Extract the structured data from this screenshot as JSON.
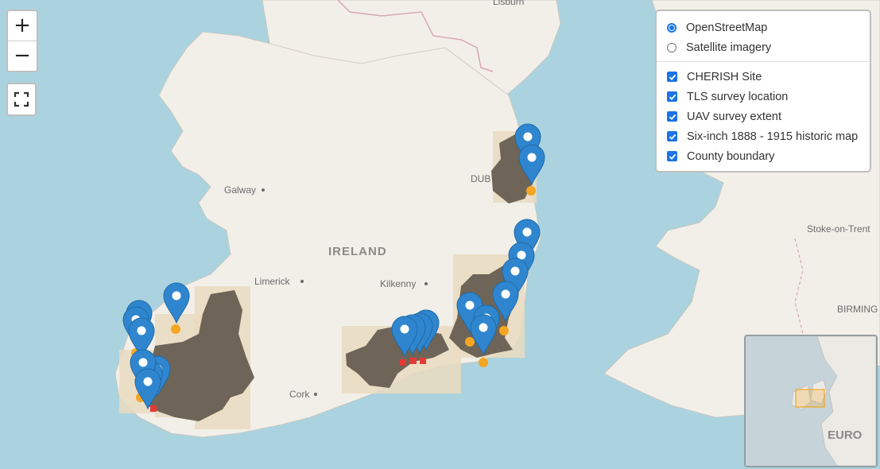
{
  "map": {
    "labels": {
      "lisburn": "Lisburn",
      "galway": "Galway",
      "dublin": "DUB",
      "ireland": "IRELAND",
      "limerick": "Limerick",
      "kilkenny": "Kilkenny",
      "cork": "Cork",
      "stoke": "Stoke-on-Trent",
      "birmingham": "BIRMING"
    }
  },
  "controls": {
    "zoom_in": "+",
    "zoom_out": "−"
  },
  "layers": {
    "base": [
      {
        "label": "OpenStreetMap",
        "selected": true
      },
      {
        "label": "Satellite imagery",
        "selected": false
      }
    ],
    "overlays": [
      {
        "label": "CHERISH Site",
        "checked": true
      },
      {
        "label": "TLS survey location",
        "checked": true
      },
      {
        "label": "UAV survey extent",
        "checked": true
      },
      {
        "label": "Six-inch 1888 - 1915 historic map",
        "checked": true
      },
      {
        "label": "County boundary",
        "checked": true
      }
    ]
  },
  "minimap": {
    "label": "EURO"
  },
  "colors": {
    "sea": "#abd3df",
    "land": "#f2efe9",
    "marker": "#2f86cf",
    "survey_dot": "#f5a623",
    "historic_map": "#6e6558",
    "historic_map_border": "#eadbc0"
  }
}
